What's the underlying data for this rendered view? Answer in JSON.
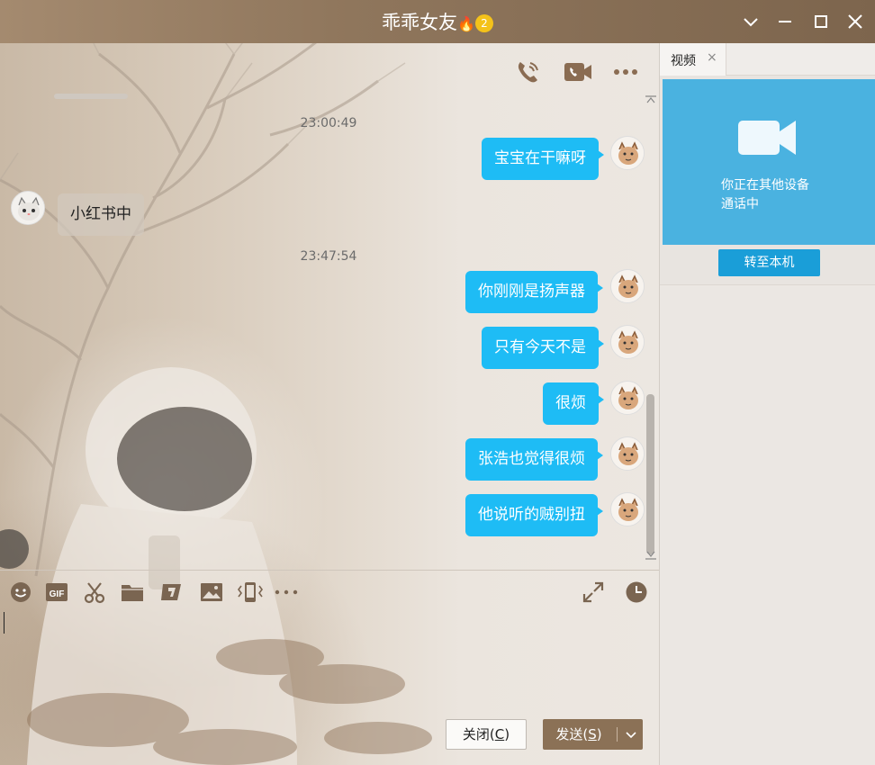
{
  "window": {
    "title": "乖乖女友",
    "title_badge_flame": "🔥",
    "title_badge_level": "2",
    "controls": [
      "chevron-down",
      "minimize",
      "maximize",
      "close"
    ]
  },
  "chat_toolbar": {
    "icons": [
      "voice-call-icon",
      "video-call-icon",
      "more-icon"
    ]
  },
  "messages": [
    {
      "type": "timestamp",
      "text": "23:00:49"
    },
    {
      "type": "out",
      "text": "宝宝在干嘛呀"
    },
    {
      "type": "in",
      "text": "小红书中"
    },
    {
      "type": "timestamp",
      "text": "23:47:54"
    },
    {
      "type": "out",
      "text": "你刚刚是扬声器"
    },
    {
      "type": "out",
      "text": "只有今天不是"
    },
    {
      "type": "out",
      "text": "很烦"
    },
    {
      "type": "out",
      "text": "张浩也觉得很烦"
    },
    {
      "type": "out",
      "text": "他说听的贼别扭"
    }
  ],
  "input_toolbar": {
    "icons": [
      "emoji-icon",
      "gif-icon",
      "scissors-icon",
      "folder-icon",
      "shake-icon",
      "image-icon",
      "vibrate-icon",
      "more-icon"
    ],
    "right_icons": [
      "expand-icon",
      "history-clock-icon"
    ]
  },
  "actions": {
    "close_label": "关闭(C)",
    "close_text": "关闭(",
    "close_key": "C",
    "close_end": ")",
    "send_text": "发送(",
    "send_key": "S",
    "send_end": ")"
  },
  "right_panel": {
    "tab_label": "视频",
    "call_message_line1": "你正在其他设备",
    "call_message_line2": "通话中",
    "transfer_button": "转至本机"
  },
  "colors": {
    "title_bar": "#8f765c",
    "outgoing_bubble": "#1ebcf5",
    "video_box": "#4ab2e0",
    "transfer_button": "#1a9ed8",
    "send_button": "#8b7156"
  }
}
